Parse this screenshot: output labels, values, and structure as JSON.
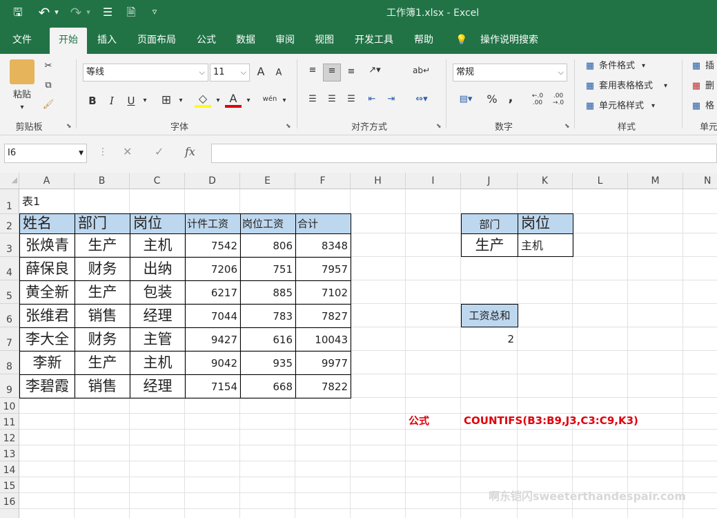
{
  "window": {
    "title": "工作簿1.xlsx  -  Excel"
  },
  "quick_access": {
    "save": "🖫",
    "undo": "↶",
    "undo_dd": "▾",
    "redo": "↷",
    "redo_dd": "▾",
    "form": "☰",
    "preview": "🗎",
    "customize": "▿"
  },
  "tabs": [
    "文件",
    "开始",
    "插入",
    "页面布局",
    "公式",
    "数据",
    "审阅",
    "视图",
    "开发工具",
    "帮助",
    "💡",
    "操作说明搜索"
  ],
  "ribbon": {
    "clipboard": {
      "label": "剪贴板",
      "paste": "粘贴",
      "paste_dd": "▾"
    },
    "font": {
      "label": "字体",
      "name": "等线",
      "size": "11",
      "grow": "A",
      "shrink": "A",
      "bold": "B",
      "italic": "I",
      "underline": "U",
      "border": "⊞",
      "fill": "◇",
      "color": "A",
      "phonetic": "wén",
      "dd": "▾"
    },
    "align": {
      "label": "对齐方式"
    },
    "number": {
      "label": "数字",
      "format": "常规",
      "percent": "%",
      "comma": ",",
      "inc": "←.0\n.00",
      "dec": ".00\n→.0"
    },
    "styles": {
      "label": "样式",
      "cond": "条件格式",
      "table": "套用表格格式",
      "cell": "单元格样式",
      "dd": "▾"
    },
    "cells": {
      "label": "单元",
      "insert": "插",
      "delete": "删",
      "format": "格"
    }
  },
  "formula_bar": {
    "name_box": "I6",
    "fx": "fx",
    "cancel": "✕",
    "enter": "✓",
    "value": ""
  },
  "columns": [
    "A",
    "B",
    "C",
    "D",
    "E",
    "F",
    "H",
    "I",
    "J",
    "K",
    "L",
    "M",
    "N"
  ],
  "rows": [
    "1",
    "2",
    "3",
    "4",
    "5",
    "6",
    "7",
    "8",
    "9",
    "10",
    "11",
    "12",
    "13",
    "14",
    "15",
    "16"
  ],
  "sheet": {
    "a1": "表1",
    "headers": [
      "姓名",
      "部门",
      "岗位",
      "计件工资",
      "岗位工资",
      "合计"
    ],
    "data": [
      [
        "张焕青",
        "生产",
        "主机",
        "7542",
        "806",
        "8348"
      ],
      [
        "薛保良",
        "财务",
        "出纳",
        "7206",
        "751",
        "7957"
      ],
      [
        "黄全新",
        "生产",
        "包装",
        "6217",
        "885",
        "7102"
      ],
      [
        "张维君",
        "销售",
        "经理",
        "7044",
        "783",
        "7827"
      ],
      [
        "李大全",
        "财务",
        "主管",
        "9427",
        "616",
        "10043"
      ],
      [
        "李新",
        "生产",
        "主机",
        "9042",
        "935",
        "9977"
      ],
      [
        "李碧霞",
        "销售",
        "经理",
        "7154",
        "668",
        "7822"
      ]
    ],
    "crit_hdr_dept": "部门",
    "crit_hdr_pos": "岗位",
    "crit_dept": "生产",
    "crit_pos": "主机",
    "sum_label": "工资总和",
    "sum_value": "2",
    "formula_label": "公式",
    "formula_text": "COUNTIFS(B3:B9,J3,C3:C9,K3)"
  },
  "watermark": "啊东铠闪sweeterthandespair.com"
}
